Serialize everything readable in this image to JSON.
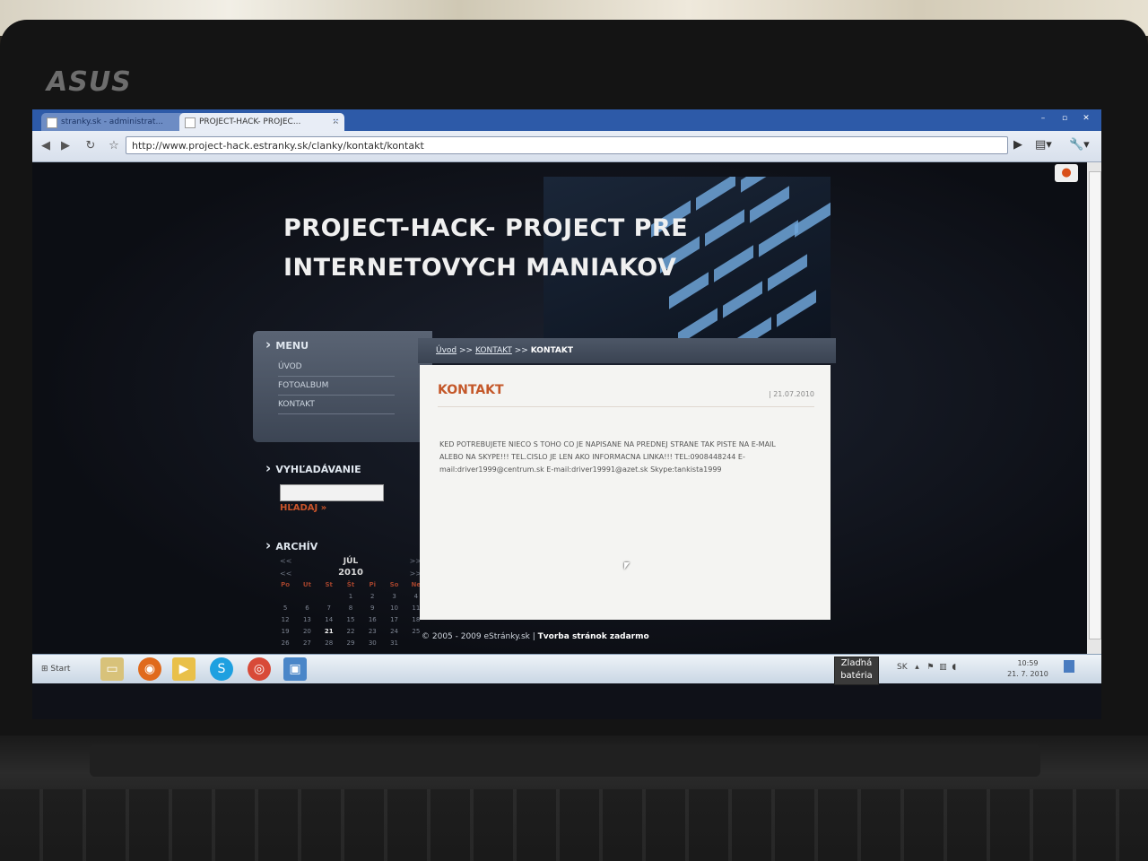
{
  "device": {
    "brand": "ASUS"
  },
  "browser": {
    "tabs": [
      {
        "label": "stranky.sk - administrat...",
        "active": false
      },
      {
        "label": "PROJECT-HACK- PROJEC...",
        "active": true
      }
    ],
    "tab_close": "×",
    "new_tab": "+",
    "url": "http://www.project-hack.estranky.sk/clanky/kontakt/kontakt"
  },
  "site": {
    "title_line1": "PROJECT-HACK- PROJECT PRE",
    "title_line2": "INTERNETOVYCH MANIAKOV",
    "menu": {
      "heading": "MENU",
      "items": [
        "ÚVOD",
        "FOTOALBUM",
        "KONTAKT"
      ]
    },
    "search": {
      "heading": "VYHĽADÁVANIE",
      "value": "",
      "button": "HĽADAJ »"
    },
    "archive": {
      "heading": "ARCHÍV",
      "month": "JÚL",
      "year": "2010",
      "prev": "<<",
      "next": ">>",
      "day_names": [
        "Po",
        "Ut",
        "St",
        "Št",
        "Pi",
        "So",
        "Ne"
      ],
      "today": "21",
      "weeks": [
        [
          "",
          "",
          "",
          "1",
          "2",
          "3",
          "4"
        ],
        [
          "5",
          "6",
          "7",
          "8",
          "9",
          "10",
          "11"
        ],
        [
          "12",
          "13",
          "14",
          "15",
          "16",
          "17",
          "18"
        ],
        [
          "19",
          "20",
          "21",
          "22",
          "23",
          "24",
          "25"
        ],
        [
          "26",
          "27",
          "28",
          "29",
          "30",
          "31",
          ""
        ]
      ]
    },
    "breadcrumb": {
      "home": "Úvod",
      "sep": ">>",
      "section": "KONTAKT",
      "current": "KONTAKT"
    },
    "article": {
      "title": "KONTAKT",
      "date": "| 21.07.2010",
      "body": "KED POTREBUJETE NIECO S TOHO CO JE NAPISANE NA PREDNEJ STRANE TAK PISTE NA E-MAIL ALEBO NA SKYPE!!! TEL.CISLO JE LEN AKO INFORMACNA LINKA!!! TEL:0908448244 E-mail:driver1999@centrum.sk E-mail:driver19991@azet.sk Skype:tankista1999"
    },
    "footer": {
      "copyright": "© 2005 - 2009 eStránky.sk |",
      "link": "Tvorba stránok zadarmo"
    }
  },
  "taskbar": {
    "start_label": "Start",
    "battery_label_1": "Zlaďná",
    "battery_label_2": "batéria",
    "language": "SK",
    "time": "10:59",
    "date": "21. 7. 2010"
  }
}
